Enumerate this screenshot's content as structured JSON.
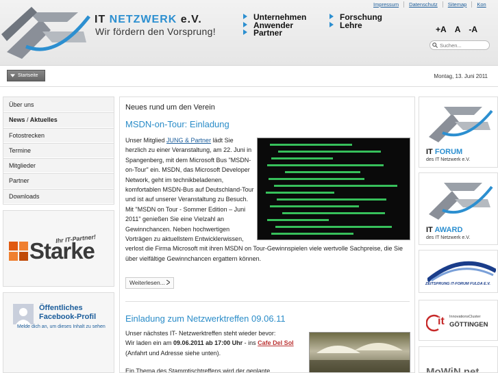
{
  "header": {
    "org_name_prefix": "IT",
    "org_name_accent": "NETZWERK",
    "org_name_suffix": "e.V.",
    "slogan": "Wir fördern den Vorsprung!",
    "nav_col1": [
      "Unternehmen",
      "Anwender",
      "Partner"
    ],
    "nav_col2": [
      "Forschung",
      "Lehre"
    ],
    "meta_links": [
      "Impressum",
      "Datenschutz",
      "Sitemap",
      "Kon"
    ],
    "font_tools": [
      "+A",
      "A",
      "-A"
    ],
    "search_placeholder": "Suchen...",
    "accent_color": "#2c8fd0"
  },
  "breadcrumb": {
    "start_label": "Startseite",
    "date": "Montag, 13. Juni 2011"
  },
  "sidebar": {
    "items": [
      "Über uns",
      "News",
      "/",
      "Aktuelles",
      "Fotostrecken",
      "Termine",
      "Mitglieder",
      "Partner",
      "Downloads"
    ]
  },
  "partner": {
    "tagline": "Ihr IT-Partner!",
    "name": "Starke"
  },
  "facebook": {
    "title": "Öffentliches Facebook-Profil",
    "text": "Melde dich an, um dieses Inhalt zu sehen"
  },
  "main": {
    "section_title": "Neues rund um den Verein",
    "article1": {
      "title": "MSDN-on-Tour: Einladung",
      "p1": "Unser Mitglied",
      "link": "JUNG & Partner",
      "p2": "lädt Sie herzlich zu einer Veranstaltung, am 22. Juni in Spangenberg, mit dem Microsoft Bus \"MSDN-on-Tour\" ein. MSDN, das Microsoft Developer Network, geht im technikbeladenen, komfortablen MSDN-Bus auf Deutschland-Tour und ist auf unserer Veranstaltung zu Besuch. Mit \"MSDN on Tour - Sommer Edition – Juni 2011\" genießen Sie eine Vielzahl an Gewinnchancen. Neben hochwertigen Vorträgen zu aktuellstem Entwicklerwissen, verlost die Firma Microsoft mit ihren MSDN on Tour-Gewinnspielen viele wertvolle Sachpreise, die Sie über vielfältige Gewinnchancen ergattern können.",
      "more": "Weiterlesen..."
    },
    "article2": {
      "title": "Einladung zum Netzwerktreffen 09.06.11",
      "line1": "Unser nächstes IT- Netzwerktreffen steht wieder bevor:",
      "line2a": "Wir laden ein am",
      "line2b": "09.06.2011 ab 17:00 Uhr",
      "line2c": "- ins",
      "cafe": "Cafe Del Sol",
      "line3": "(Anfahrt und Adresse siehe unten).",
      "line4": "Ein Thema des Stammtischtreffens wird der geplante"
    }
  },
  "right": {
    "forum": {
      "accent": "FORUM",
      "prefix": "IT",
      "sub": "des IT Netzwerk e.V."
    },
    "award": {
      "accent": "AWARD",
      "prefix": "IT",
      "sub": "des IT Netzwerk e.V."
    },
    "zeitsprung": "ZEITSPRUNG IT-FORUM FULDA E.V.",
    "goettingen": {
      "it": "it",
      "small": "InnovationsCluster",
      "name": "GÖTTINGEN"
    },
    "mowin": "MoWiN.net"
  }
}
